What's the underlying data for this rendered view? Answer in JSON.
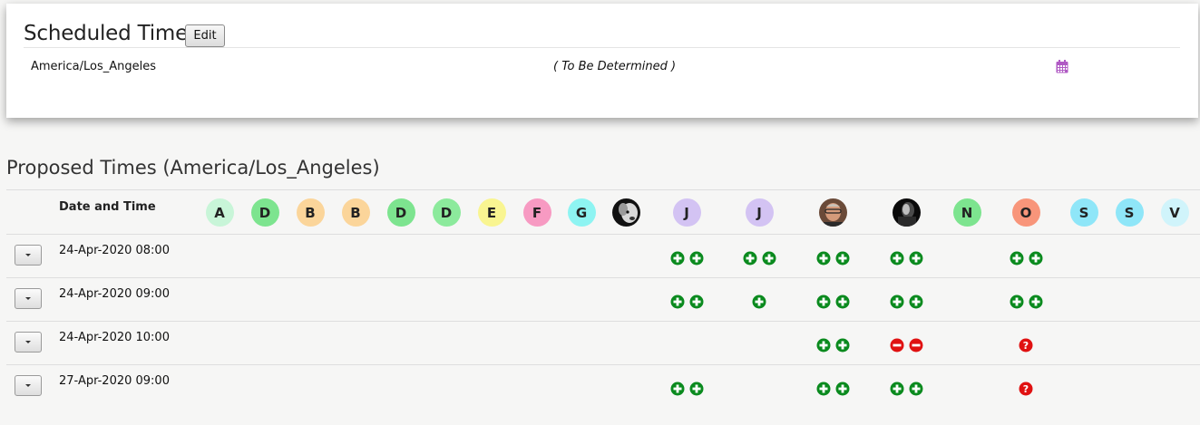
{
  "scheduled": {
    "title": "Scheduled Time",
    "edit_label": "Edit",
    "timezone": "America/Los_Angeles",
    "time": "( To Be Determined )",
    "calendar_icon": "calendar-icon",
    "calendar_color": "#b05ac4"
  },
  "proposed": {
    "title": "Proposed Times (America/Los_Angeles)",
    "date_header": "Date and Time",
    "participants": [
      {
        "initial": "A",
        "color": "#c8f5d8"
      },
      {
        "initial": "D",
        "color": "#7de48f"
      },
      {
        "initial": "B",
        "color": "#fbd59a"
      },
      {
        "initial": "B",
        "color": "#fbd59a"
      },
      {
        "initial": "D",
        "color": "#7de48f"
      },
      {
        "initial": "D",
        "color": "#8cea9c"
      },
      {
        "initial": "E",
        "color": "#f9f591"
      },
      {
        "initial": "F",
        "color": "#f79ac2"
      },
      {
        "initial": "G",
        "color": "#8ef4f2"
      },
      {
        "initial": "",
        "photo": "dog"
      },
      {
        "initial": "J",
        "color": "#d3c3f3"
      },
      {
        "initial": "J",
        "color": "#d3c3f3"
      },
      {
        "initial": "",
        "photo": "man"
      },
      {
        "initial": "",
        "photo": "bw"
      },
      {
        "initial": "N",
        "color": "#7de48f"
      },
      {
        "initial": "O",
        "color": "#f8957a"
      },
      {
        "initial": "S",
        "color": "#8fe6f8"
      },
      {
        "initial": "S",
        "color": "#8fe6f8"
      },
      {
        "initial": "V",
        "color": "#d0f4fb"
      }
    ],
    "rows": [
      {
        "date": "24-Apr-2020 08:00",
        "votes": [
          {
            "participant": 10,
            "icons": [
              "yes",
              "yes"
            ]
          },
          {
            "participant": 11,
            "icons": [
              "yes",
              "yes"
            ]
          },
          {
            "participant": 12,
            "icons": [
              "yes",
              "yes"
            ]
          },
          {
            "participant": 13,
            "icons": [
              "yes",
              "yes"
            ]
          },
          {
            "participant": 15,
            "icons": [
              "yes",
              "yes"
            ]
          }
        ]
      },
      {
        "date": "24-Apr-2020 09:00",
        "votes": [
          {
            "participant": 10,
            "icons": [
              "yes",
              "yes"
            ]
          },
          {
            "participant": 11,
            "icons": [
              "yes"
            ]
          },
          {
            "participant": 12,
            "icons": [
              "yes",
              "yes"
            ]
          },
          {
            "participant": 13,
            "icons": [
              "yes",
              "yes"
            ]
          },
          {
            "participant": 15,
            "icons": [
              "yes",
              "yes"
            ]
          }
        ]
      },
      {
        "date": "24-Apr-2020 10:00",
        "votes": [
          {
            "participant": 12,
            "icons": [
              "yes",
              "yes"
            ]
          },
          {
            "participant": 13,
            "icons": [
              "no",
              "no"
            ]
          },
          {
            "participant": 15,
            "icons": [
              "maybe"
            ]
          }
        ]
      },
      {
        "date": "27-Apr-2020 09:00",
        "votes": [
          {
            "participant": 10,
            "icons": [
              "yes",
              "yes"
            ]
          },
          {
            "participant": 12,
            "icons": [
              "yes",
              "yes"
            ]
          },
          {
            "participant": 13,
            "icons": [
              "yes",
              "yes"
            ]
          },
          {
            "participant": 15,
            "icons": [
              "maybe"
            ]
          }
        ]
      }
    ]
  },
  "icon_colors": {
    "yes": "#0a8a1e",
    "no": "#e01111",
    "maybe": "#e01111"
  }
}
